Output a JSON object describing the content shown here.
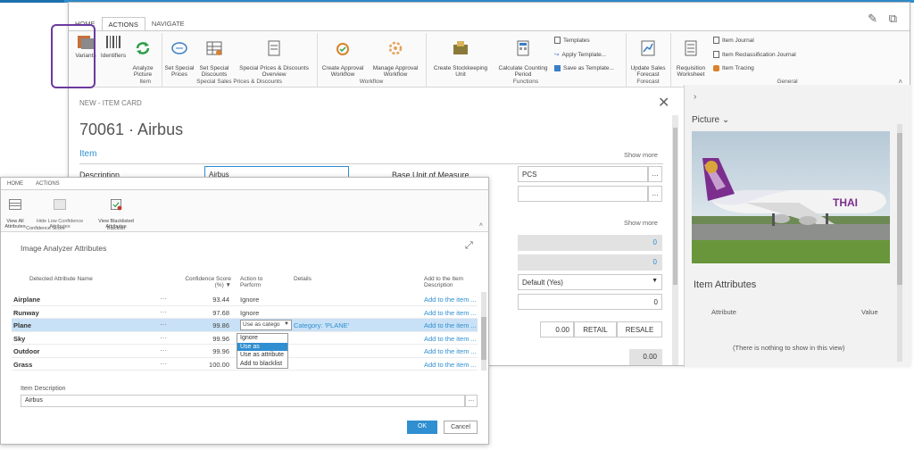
{
  "main": {
    "tabs": [
      {
        "label": "HOME"
      },
      {
        "label": "ACTIONS"
      },
      {
        "label": "NAVIGATE"
      }
    ],
    "ribbon": {
      "buttons": [
        {
          "label": "Variants"
        },
        {
          "label": "Identifiers"
        },
        {
          "label": "Analyze\nPicture"
        },
        {
          "label": "Set Special\nPrices"
        },
        {
          "label": "Set Special\nDiscounts"
        },
        {
          "label": "Special Prices & Discounts\nOverview"
        },
        {
          "label": "Create Approval\nWorkflow"
        },
        {
          "label": "Manage Approval\nWorkflow"
        },
        {
          "label": "Create Stockkeeping\nUnit"
        },
        {
          "label": "Calculate Counting\nPeriod"
        },
        {
          "label": "Update Sales\nForecast"
        },
        {
          "label": "Requisition\nWorksheet"
        }
      ],
      "small_items": {
        "templates": "Templates",
        "apply_template": "Apply Template...",
        "save_template": "Save as Template...",
        "item_journal": "Item Journal",
        "item_reclass": "Item Reclassification Journal",
        "item_tracing": "Item Tracing"
      },
      "groups": [
        {
          "label": "Item"
        },
        {
          "label": "Special Sales Prices & Discounts"
        },
        {
          "label": "Workflow"
        },
        {
          "label": "Functions"
        },
        {
          "label": "Forecast"
        },
        {
          "label": "General"
        }
      ]
    },
    "card": {
      "caption": "NEW - ITEM CARD",
      "title": "70061 · Airbus",
      "section": "Item",
      "show_more": "Show more",
      "show_more_2": "Show more",
      "description_label": "Description",
      "description_value": "Airbus",
      "base_uom_label": "Base Unit of Measure",
      "base_uom_value": "PCS",
      "field_0a": "0",
      "field_0b": "0",
      "default_yes": "Default (Yes)",
      "field_0c": "0",
      "price_value": "0.00",
      "retail": "RETAIL",
      "resale": "RESALE",
      "bottom_value": "0.00"
    },
    "pane": {
      "picture_label": "Picture",
      "attributes_title": "Item Attributes",
      "col_attribute": "Attribute",
      "col_value": "Value",
      "empty": "(There is nothing to show in this view)"
    }
  },
  "analyzer": {
    "tabs": [
      {
        "label": "HOME"
      },
      {
        "label": "ACTIONS"
      }
    ],
    "buttons": [
      {
        "label": "View All\nAttributes"
      },
      {
        "label": "Hide Low Confidence\nAttributes"
      },
      {
        "label": "View Blacklisted\nAttributes"
      }
    ],
    "groups": [
      {
        "label": "Confidence Score"
      },
      {
        "label": "Blacklist"
      }
    ],
    "title": "Image Analyzer Attributes",
    "columns": {
      "name": "Detected Attribute Name",
      "score": "Confidence Score\n(%) ▼",
      "action": "Action to\nPerform",
      "details": "Details",
      "add": "Add to the Item\nDescription"
    },
    "rows": [
      {
        "name": "Airplane",
        "score": "93.44",
        "action": "Ignore",
        "details": "",
        "add": "Add to the item ..."
      },
      {
        "name": "Runway",
        "score": "97.68",
        "action": "Ignore",
        "details": "",
        "add": "Add to the item ..."
      },
      {
        "name": "Plane",
        "score": "99.86",
        "action": "Use as catego",
        "details": "Category: 'PLANE'",
        "add": "Add to the item ..."
      },
      {
        "name": "Sky",
        "score": "99.96",
        "action": "",
        "details": "",
        "add": "Add to the item ..."
      },
      {
        "name": "Outdoor",
        "score": "99.96",
        "action": "",
        "details": "",
        "add": "Add to the item ..."
      },
      {
        "name": "Grass",
        "score": "100.00",
        "action": "",
        "details": "",
        "add": "Add to the item ..."
      }
    ],
    "dropdown_options": [
      "Ignore",
      "Use as category",
      "Use as attribute",
      "Add to blacklist"
    ],
    "item_desc_label": "Item Description",
    "item_desc_value": "Airbus",
    "ok": "OK",
    "cancel": "Cancel"
  },
  "colors": {
    "accent": "#2f8fd1",
    "highlight": "#6b3a9e",
    "selected_row": "#c8e1f6"
  }
}
